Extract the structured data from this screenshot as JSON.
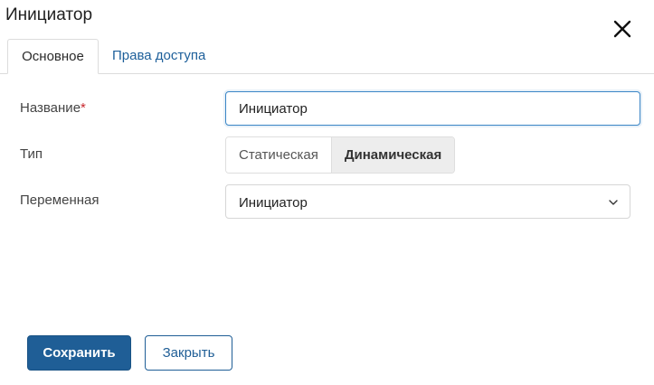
{
  "dialog": {
    "title": "Инициатор",
    "close_icon": "close-icon"
  },
  "tabs": [
    {
      "label": "Основное",
      "active": true
    },
    {
      "label": "Права доступа",
      "active": false
    }
  ],
  "form": {
    "name": {
      "label": "Название",
      "required_mark": "*",
      "value": "Инициатор"
    },
    "type": {
      "label": "Тип",
      "options": [
        "Статическая",
        "Динамическая"
      ],
      "selected": "Динамическая"
    },
    "variable": {
      "label": "Переменная",
      "value": "Инициатор",
      "arrow_icon": "chevron-down-icon"
    }
  },
  "footer": {
    "save_label": "Сохранить",
    "close_label": "Закрыть"
  },
  "colors": {
    "primary": "#1f5e96",
    "link": "#1d5f9a",
    "required": "#c8282e",
    "focus_border": "#3b86c6"
  }
}
